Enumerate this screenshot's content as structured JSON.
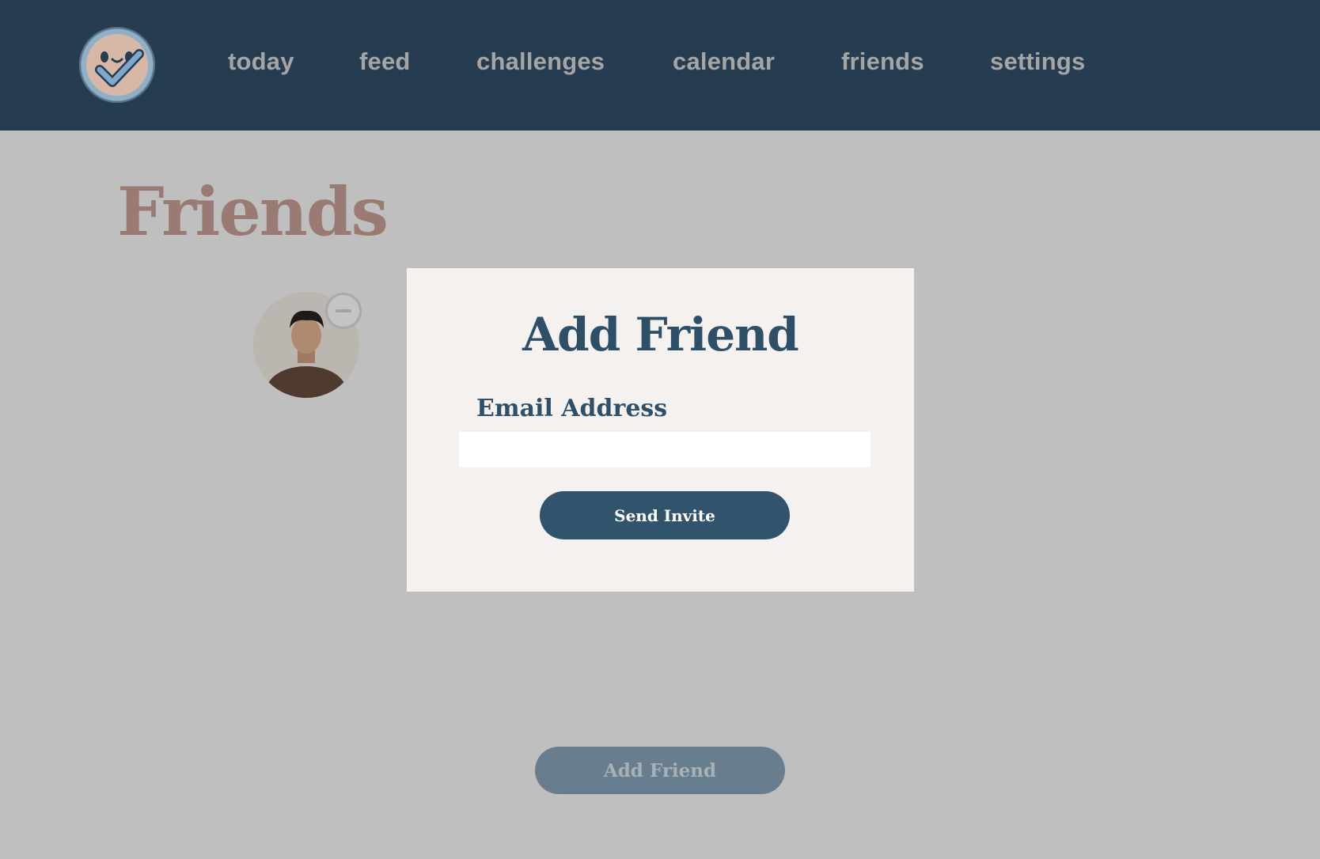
{
  "nav": {
    "logo_icon": "smiley-checkmark-logo-icon",
    "links": [
      {
        "label": "today"
      },
      {
        "label": "feed"
      },
      {
        "label": "challenges"
      },
      {
        "label": "calendar"
      },
      {
        "label": "friends"
      },
      {
        "label": "settings"
      }
    ]
  },
  "page": {
    "title": "Friends"
  },
  "friends": {
    "items": [
      {
        "avatar_icon": "friend-photo",
        "remove_icon": "minus-circle-icon"
      }
    ],
    "add_button_label": "Add Friend"
  },
  "modal": {
    "title": "Add Friend",
    "email_label": "Email Address",
    "email_value": "",
    "email_placeholder": "",
    "send_label": "Send Invite"
  },
  "colors": {
    "navbar": "#263c50",
    "overlay": "#bfbfbf",
    "title": "#9a7b74",
    "accent": "#2e4f68",
    "modal_bg": "#f4f1ef"
  }
}
